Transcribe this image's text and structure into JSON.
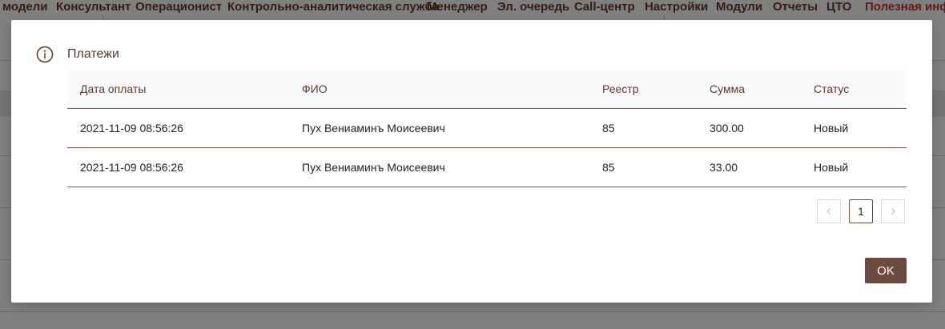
{
  "nav": {
    "items": [
      {
        "label": "модели"
      },
      {
        "label": "Консультант"
      },
      {
        "label": "Операционист"
      },
      {
        "label": "Контрольно-аналитическая служба"
      },
      {
        "label": "Менеджер"
      },
      {
        "label": "Эл. очередь"
      },
      {
        "label": "Call-центр"
      },
      {
        "label": "Настройки"
      },
      {
        "label": "Модули"
      },
      {
        "label": "Отчеты"
      },
      {
        "label": "ЦТО"
      },
      {
        "label": "Полезная инфо"
      }
    ]
  },
  "modal": {
    "icon": "info-circle-icon",
    "title": "Платежи",
    "ok_label": "OK"
  },
  "table": {
    "columns": [
      "Дата оплаты",
      "ФИО",
      "Реестр",
      "Сумма",
      "Статус"
    ],
    "rows": [
      [
        "2021-11-09 08:56:26",
        "Пух Вениаминъ Моисеевич",
        "85",
        "300.00",
        "Новый"
      ],
      [
        "2021-11-09 08:56:26",
        "Пух Вениаминъ Моисеевич",
        "85",
        "33.00",
        "Новый"
      ]
    ]
  },
  "pagination": {
    "current_page": "1",
    "prev_icon": "chevron-left-icon",
    "next_icon": "chevron-right-icon"
  },
  "colors": {
    "accent": "#6b4b3e",
    "nav_text": "#6b3a26",
    "nav_highlight": "#c0392b"
  }
}
